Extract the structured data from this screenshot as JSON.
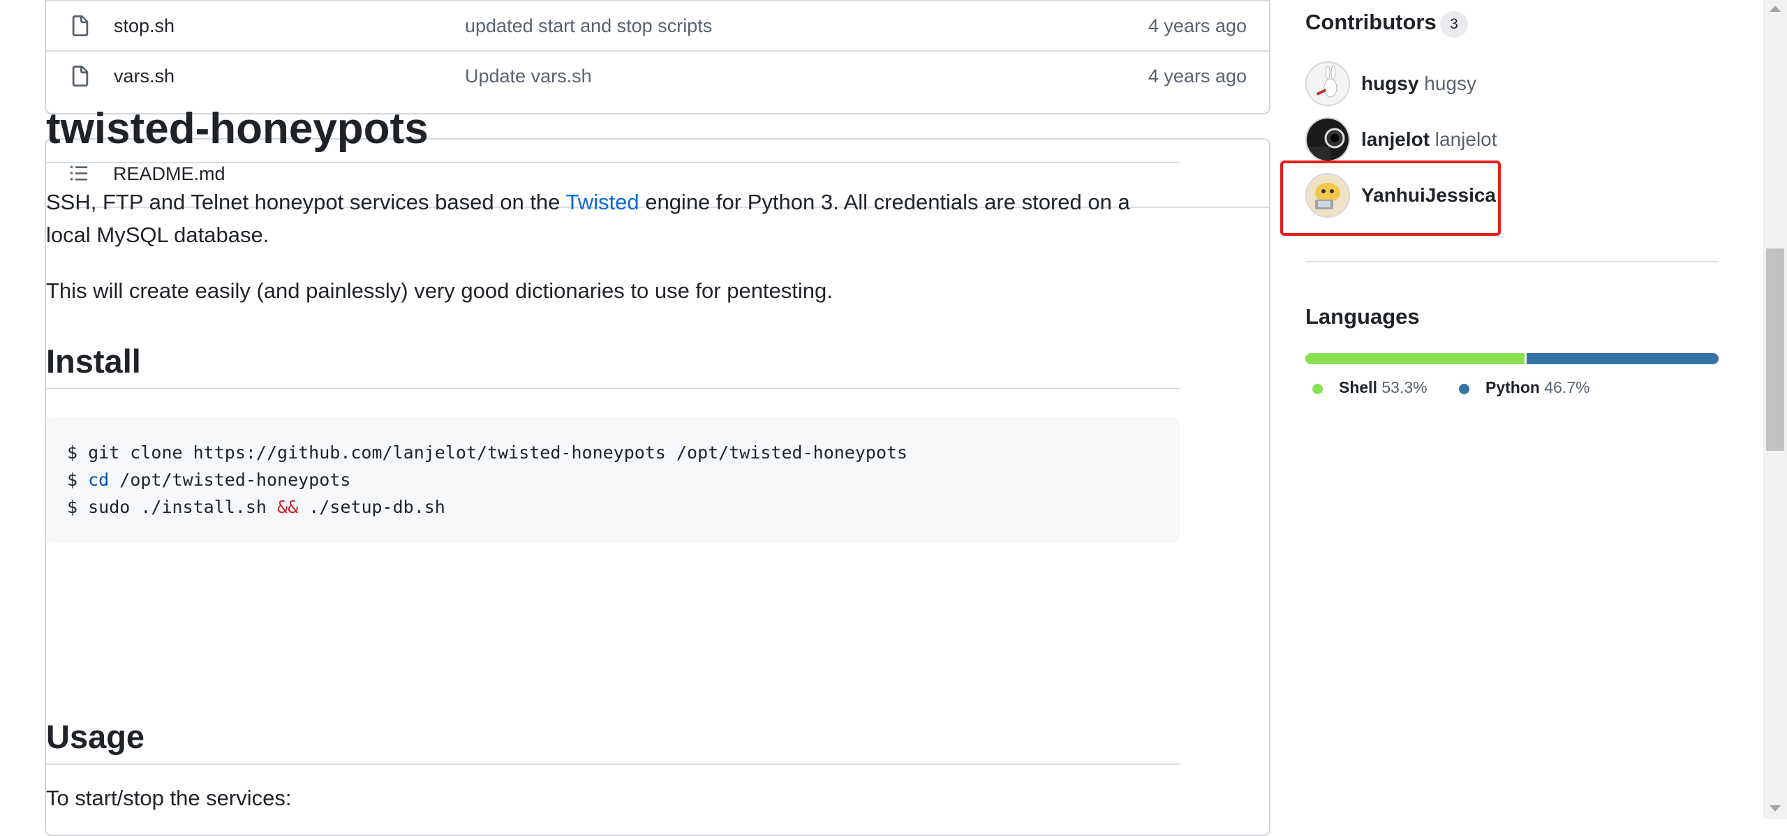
{
  "files": [
    {
      "name": "stop.sh",
      "message": "updated start and stop scripts",
      "age": "4 years ago"
    },
    {
      "name": "vars.sh",
      "message": "Update vars.sh",
      "age": "4 years ago"
    }
  ],
  "readme": {
    "filename": "README.md",
    "title": "twisted-honeypots",
    "intro_before_link": "SSH, FTP and Telnet honeypot services based on the ",
    "intro_link": "Twisted",
    "intro_after_link_line1": " engine for Python 3. All credentials are stored on a",
    "intro_line2": "local MySQL database.",
    "paragraph2": "This will create easily (and painlessly) very good dictionaries to use for pentesting.",
    "install_heading": "Install",
    "code": {
      "line1": "$ git clone https://github.com/lanjelot/twisted-honeypots /opt/twisted-honeypots",
      "line2_prefix": "$ ",
      "line2_kw": "cd",
      "line2_rest": " /opt/twisted-honeypots",
      "line3_prefix": "$ sudo ./install.sh ",
      "line3_op": "&&",
      "line3_rest": " ./setup-db.sh"
    },
    "usage_heading": "Usage",
    "usage_text": "To start/stop the services:"
  },
  "sidebar": {
    "contributors_heading": "Contributors",
    "contributors_count": "3",
    "contributors": [
      {
        "login": "hugsy",
        "name": "hugsy"
      },
      {
        "login": "lanjelot",
        "name": "lanjelot"
      },
      {
        "login": "YanhuiJessica",
        "name": ""
      }
    ],
    "languages_heading": "Languages",
    "languages": [
      {
        "name": "Shell",
        "percent": "53.3%",
        "fraction": 0.533,
        "color": "#89e051"
      },
      {
        "name": "Python",
        "percent": "46.7%",
        "fraction": 0.467,
        "color": "#3572A5"
      }
    ]
  },
  "colors": {
    "link": "#0969da",
    "highlight_box": "#e0201a",
    "border": "#d0d7de"
  }
}
